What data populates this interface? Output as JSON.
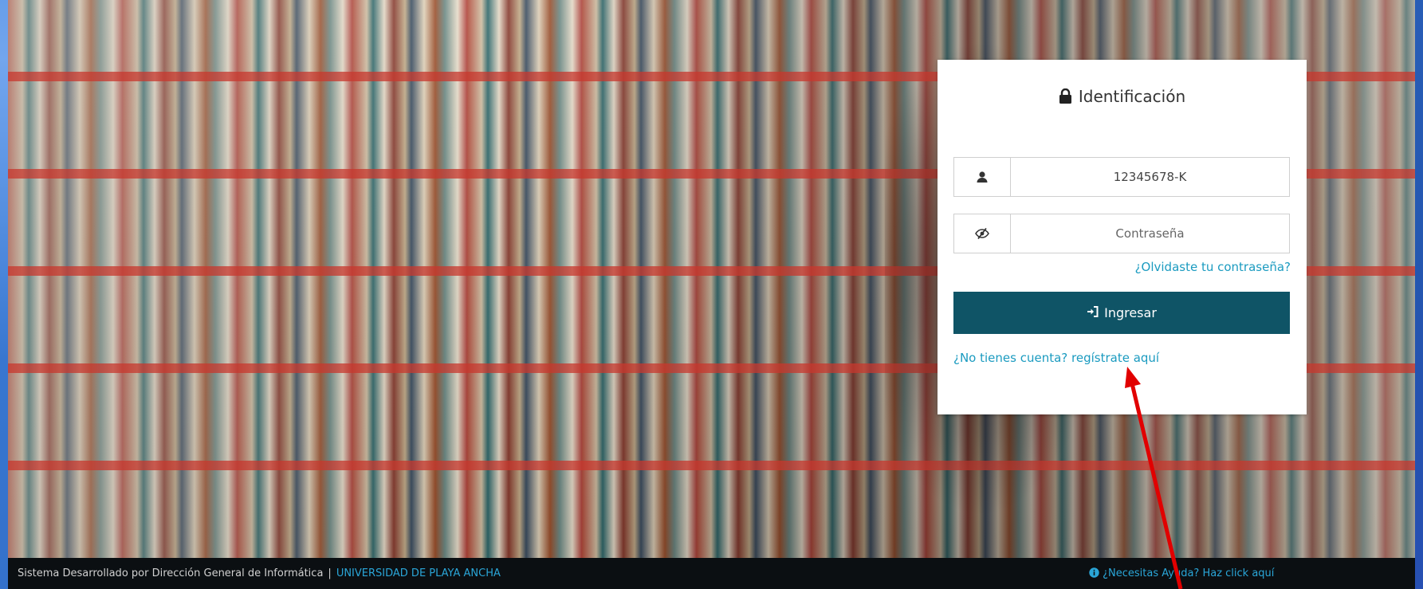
{
  "login": {
    "title": "Identificación",
    "username_value": "12345678-K",
    "password_placeholder": "Contraseña",
    "forgot_link": "¿Olvidaste tu contraseña?",
    "login_button": "Ingresar",
    "register_link": "¿No tienes cuenta? regístrate aquí"
  },
  "footer": {
    "developed_by": "Sistema Desarrollado por Dirección General de Informática",
    "separator": "|",
    "university": "UNIVERSIDAD DE PLAYA ANCHA",
    "help_link": "¿Necesitas Ayuda? Haz click aquí"
  },
  "colors": {
    "button": "#0f5466",
    "link": "#1b9bc0",
    "annotation_arrow": "#e10000"
  },
  "icons": [
    "lock-icon",
    "user-icon",
    "eye-slash-icon",
    "sign-in-icon",
    "info-circle-icon"
  ]
}
